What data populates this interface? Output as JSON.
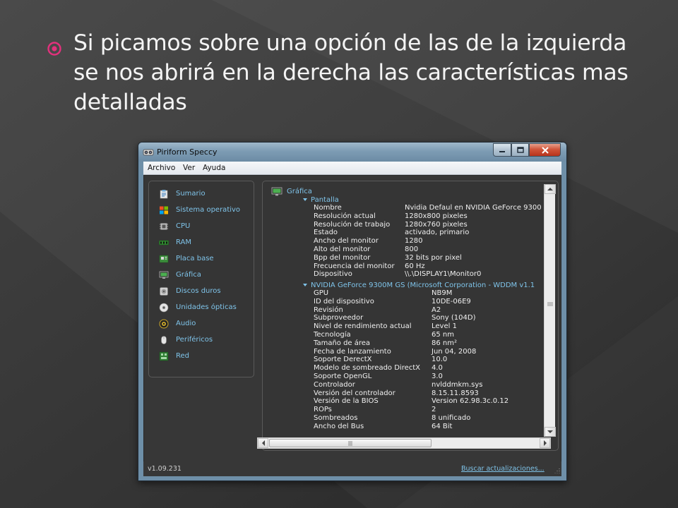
{
  "slide": {
    "bullet_text": "Si picamos sobre una opción de las de la izquierda se nos abrirá en la derecha las características mas detalladas",
    "accent_color": "#e2317c"
  },
  "window": {
    "title": "Piriform Speccy",
    "menu": [
      "Archivo",
      "Ver",
      "Ayuda"
    ],
    "version": "v1.09.231",
    "update_link": "Buscar actualizaciones..."
  },
  "sidebar": {
    "items": [
      {
        "label": "Sumario",
        "icon": "clipboard-icon"
      },
      {
        "label": "Sistema operativo",
        "icon": "windows-icon"
      },
      {
        "label": "CPU",
        "icon": "cpu-icon"
      },
      {
        "label": "RAM",
        "icon": "ram-icon"
      },
      {
        "label": "Placa base",
        "icon": "motherboard-icon"
      },
      {
        "label": "Gráfica",
        "icon": "monitor-icon"
      },
      {
        "label": "Discos duros",
        "icon": "hard-disk-icon"
      },
      {
        "label": "Unidades ópticas",
        "icon": "optical-disc-icon"
      },
      {
        "label": "Audio",
        "icon": "speaker-icon"
      },
      {
        "label": "Periféricos",
        "icon": "mouse-icon"
      },
      {
        "label": "Red",
        "icon": "network-icon"
      }
    ]
  },
  "content": {
    "section_title": "Gráfica",
    "pantalla_title": "Pantalla",
    "pantalla": [
      {
        "k": "Nombre",
        "v": "Nvidia Defaul en NVIDIA GeForce 9300"
      },
      {
        "k": "Resolución actual",
        "v": "1280x800 pixeles"
      },
      {
        "k": "Resolución de trabajo",
        "v": "1280x760 pixeles"
      },
      {
        "k": "Estado",
        "v": "activado, primario"
      },
      {
        "k": "Ancho del monitor",
        "v": "1280"
      },
      {
        "k": "Alto del monitor",
        "v": "800"
      },
      {
        "k": "Bpp del monitor",
        "v": "32 bits por pixel"
      },
      {
        "k": "Frecuencia del monitor",
        "v": "60 Hz"
      },
      {
        "k": "Dispositivo",
        "v": "\\\\.\\DISPLAY1\\Monitor0"
      }
    ],
    "gpu_title": "NVIDIA GeForce 9300M GS (Microsoft Corporation - WDDM v1.1",
    "gpu": [
      {
        "k": "GPU",
        "v": "NB9M"
      },
      {
        "k": "ID del dispositivo",
        "v": "10DE-06E9"
      },
      {
        "k": "Revisión",
        "v": "A2"
      },
      {
        "k": "Subproveedor",
        "v": "Sony (104D)"
      },
      {
        "k": "Nivel de rendimiento actual",
        "v": "Level 1"
      },
      {
        "k": "Tecnología",
        "v": "65 nm"
      },
      {
        "k": "Tamaño de área",
        "v": "86 nm²"
      },
      {
        "k": "Fecha de lanzamiento",
        "v": "Jun 04, 2008"
      },
      {
        "k": "Soporte DerectX",
        "v": "10.0"
      },
      {
        "k": "Modelo de sombreado DirectX",
        "v": "4.0"
      },
      {
        "k": "Soporte OpenGL",
        "v": "3.0"
      },
      {
        "k": "Controlador",
        "v": "nvlddmkm.sys"
      },
      {
        "k": "Versión del controlador",
        "v": "8.15.11.8593"
      },
      {
        "k": "Versión de la BIOS",
        "v": "Version 62.98.3c.0.12"
      },
      {
        "k": "ROPs",
        "v": "2"
      },
      {
        "k": "Sombreados",
        "v": "8 unificado"
      },
      {
        "k": "Ancho del Bus",
        "v": "64 Bit"
      }
    ]
  }
}
